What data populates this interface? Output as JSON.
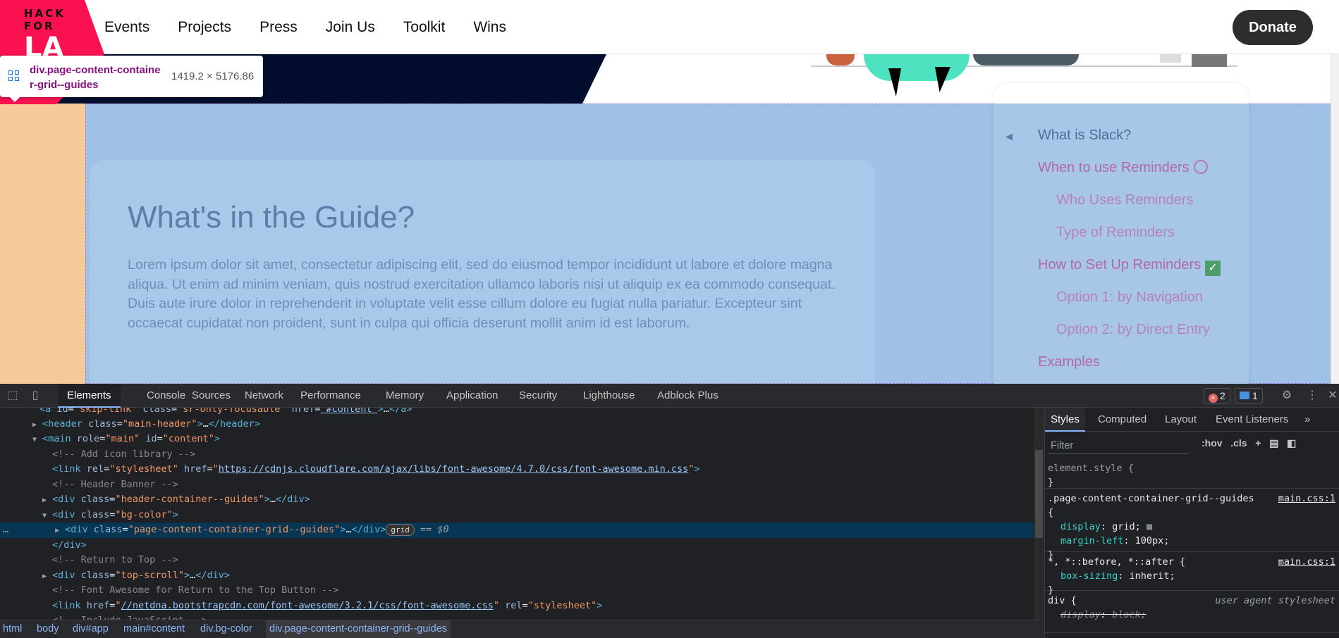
{
  "site": {
    "logo": {
      "line1": "HACK",
      "line2": "FOR",
      "line3": "LA"
    },
    "nav": [
      "Events",
      "Projects",
      "Press",
      "Join Us",
      "Toolkit",
      "Wins"
    ],
    "donate": "Donate",
    "guide": {
      "title": "What's in the Guide?",
      "body": "Lorem ipsum dolor sit amet, consectetur adipiscing elit, sed do eiusmod tempor incididunt ut labore et dolore magna aliqua. Ut enim ad minim veniam, quis nostrud exercitation ullamco laboris nisi ut aliquip ex ea commodo consequat. Duis aute irure dolor in reprehenderit in voluptate velit esse cillum dolore eu fugiat nulla pariatur. Excepteur sint occaecat cupidatat non proident, sunt in culpa qui officia deserunt mollit anim id est laborum."
    },
    "toc": [
      {
        "label": "What is Slack?",
        "level": 1,
        "color": "#4f6f96"
      },
      {
        "label": "When to use Reminders",
        "level": 1,
        "color": "#b06aa5",
        "emoji": "alarm-clock"
      },
      {
        "label": "Who Uses Reminders",
        "level": 2,
        "color": "#b583ba"
      },
      {
        "label": "Type of Reminders",
        "level": 2,
        "color": "#b583ba"
      },
      {
        "label": "How to Set Up Reminders",
        "level": 1,
        "color": "#b06aa5",
        "emoji": "check-mark"
      },
      {
        "label": "Option 1: by Navigation",
        "level": 2,
        "color": "#b583ba"
      },
      {
        "label": "Option 2: by Direct Entry",
        "level": 2,
        "color": "#b583ba"
      },
      {
        "label": "Examples",
        "level": 1,
        "color": "#b06aa5"
      }
    ],
    "tooltip": {
      "selector": "div.page-content-container-grid--guides",
      "dimensions": "1419.2 × 5176.86"
    }
  },
  "devtools": {
    "tabs": [
      "Elements",
      "Console",
      "Sources",
      "Network",
      "Performance",
      "Memory",
      "Application",
      "Security",
      "Lighthouse",
      "Adblock Plus"
    ],
    "active_tab": "Elements",
    "errors": "2",
    "messages": "1",
    "styles_tabs": [
      "Styles",
      "Computed",
      "Layout",
      "Event Listeners"
    ],
    "filter_placeholder": "Filter",
    "hov": ":hov",
    "cls": ".cls",
    "breadcrumbs": [
      "html",
      "body",
      "div#app",
      "main#content",
      "div.bg-color",
      "div.page-content-container-grid--guides"
    ],
    "eq0": "== $0",
    "grid_badge": "grid",
    "css_rules": [
      {
        "selector": "element.style {",
        "source": "",
        "props": []
      },
      {
        "selector": ".page-content-container-grid--guides",
        "source": "main.css:1",
        "props": [
          {
            "name": "display",
            "value": "grid;"
          },
          {
            "name": "margin-left",
            "value": "100px;"
          }
        ]
      },
      {
        "selector": "*, *::before, *::after {",
        "source": "main.css:1",
        "props": [
          {
            "name": "box-sizing",
            "value": "inherit;"
          }
        ]
      },
      {
        "selector": "div {",
        "source": "user agent stylesheet",
        "props": [
          {
            "name": "display",
            "value": "block;"
          }
        ]
      }
    ]
  }
}
